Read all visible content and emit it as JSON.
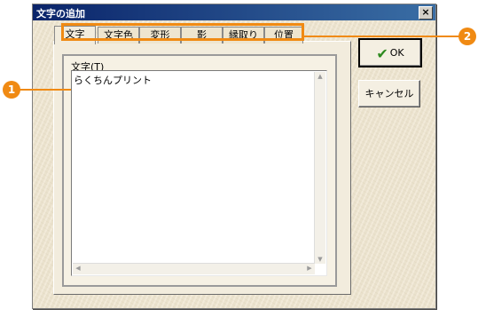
{
  "window": {
    "title": "文字の追加",
    "close_label": "×"
  },
  "tabs": [
    {
      "label": "文字",
      "active": true
    },
    {
      "label": "文字色"
    },
    {
      "label": "変形"
    },
    {
      "label": "影"
    },
    {
      "label": "縁取り"
    },
    {
      "label": "位置"
    }
  ],
  "text_field": {
    "label": "文字(T)",
    "value": "らくちんプリント"
  },
  "buttons": {
    "ok_label": "OK",
    "cancel_label": "キャンセル"
  },
  "callouts": {
    "one": "1",
    "two": "2"
  },
  "colors": {
    "accent": "#f08a13",
    "ok_check": "#2d8a1f",
    "title_bar": "#0a246a"
  },
  "icons": {
    "close": "close-icon",
    "check": "check-icon",
    "scroll_up": "scroll-up-arrow-icon",
    "scroll_down": "scroll-down-arrow-icon",
    "scroll_left": "scroll-left-arrow-icon",
    "scroll_right": "scroll-right-arrow-icon"
  }
}
